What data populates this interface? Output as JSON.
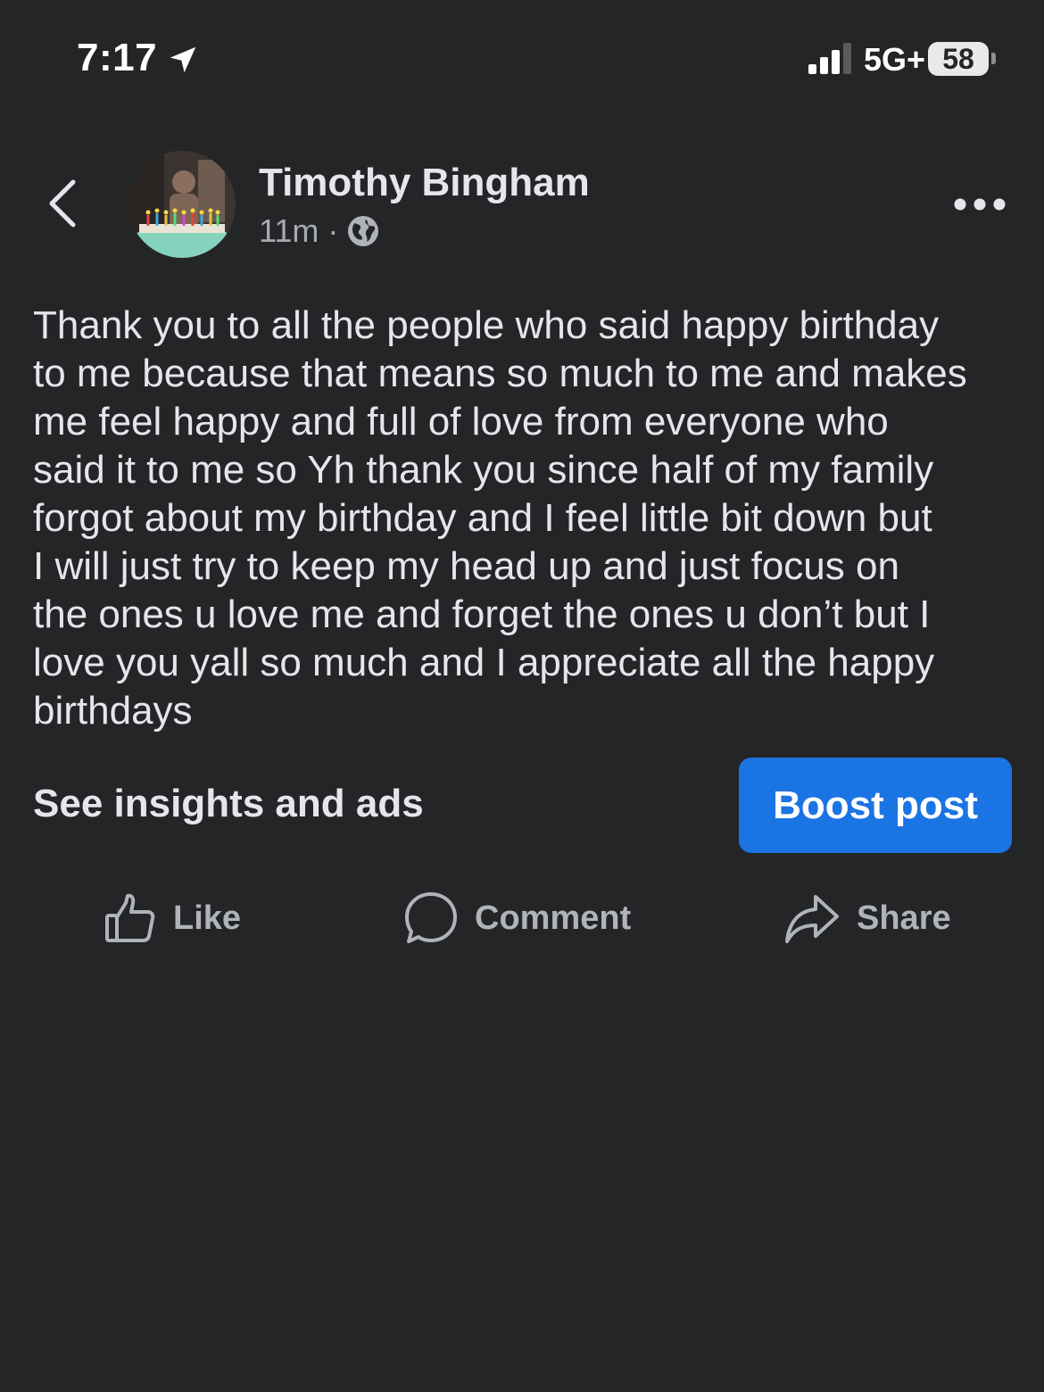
{
  "status_bar": {
    "time": "7:17",
    "network": "5G+",
    "battery": "58",
    "icons": [
      "location-arrow-icon",
      "cellular-signal-icon",
      "battery-icon"
    ]
  },
  "post": {
    "author": "Timothy Bingham",
    "time_ago": "11m",
    "separator": "·",
    "privacy_icon": "globe-icon",
    "text": "Thank you to all the people who said happy birthday\nto me because that means so much to me and makes\nme feel happy and full of love from everyone who\nsaid it to me so Yh thank you since half of my family\nforgot about my birthday and I feel little bit down but\nI will just try to keep my head up and just focus on\nthe ones u love me and forget the ones u don’t but I\nlove you yall so much and I appreciate all the happy\nbirthdays"
  },
  "insights_label": "See insights and ads",
  "boost_label": "Boost post",
  "actions": {
    "like": "Like",
    "comment": "Comment",
    "share": "Share"
  },
  "colors": {
    "background": "#242527",
    "primary_text": "#e4e6eb",
    "secondary_text": "#b0b3b8",
    "accent": "#1b74e4"
  }
}
